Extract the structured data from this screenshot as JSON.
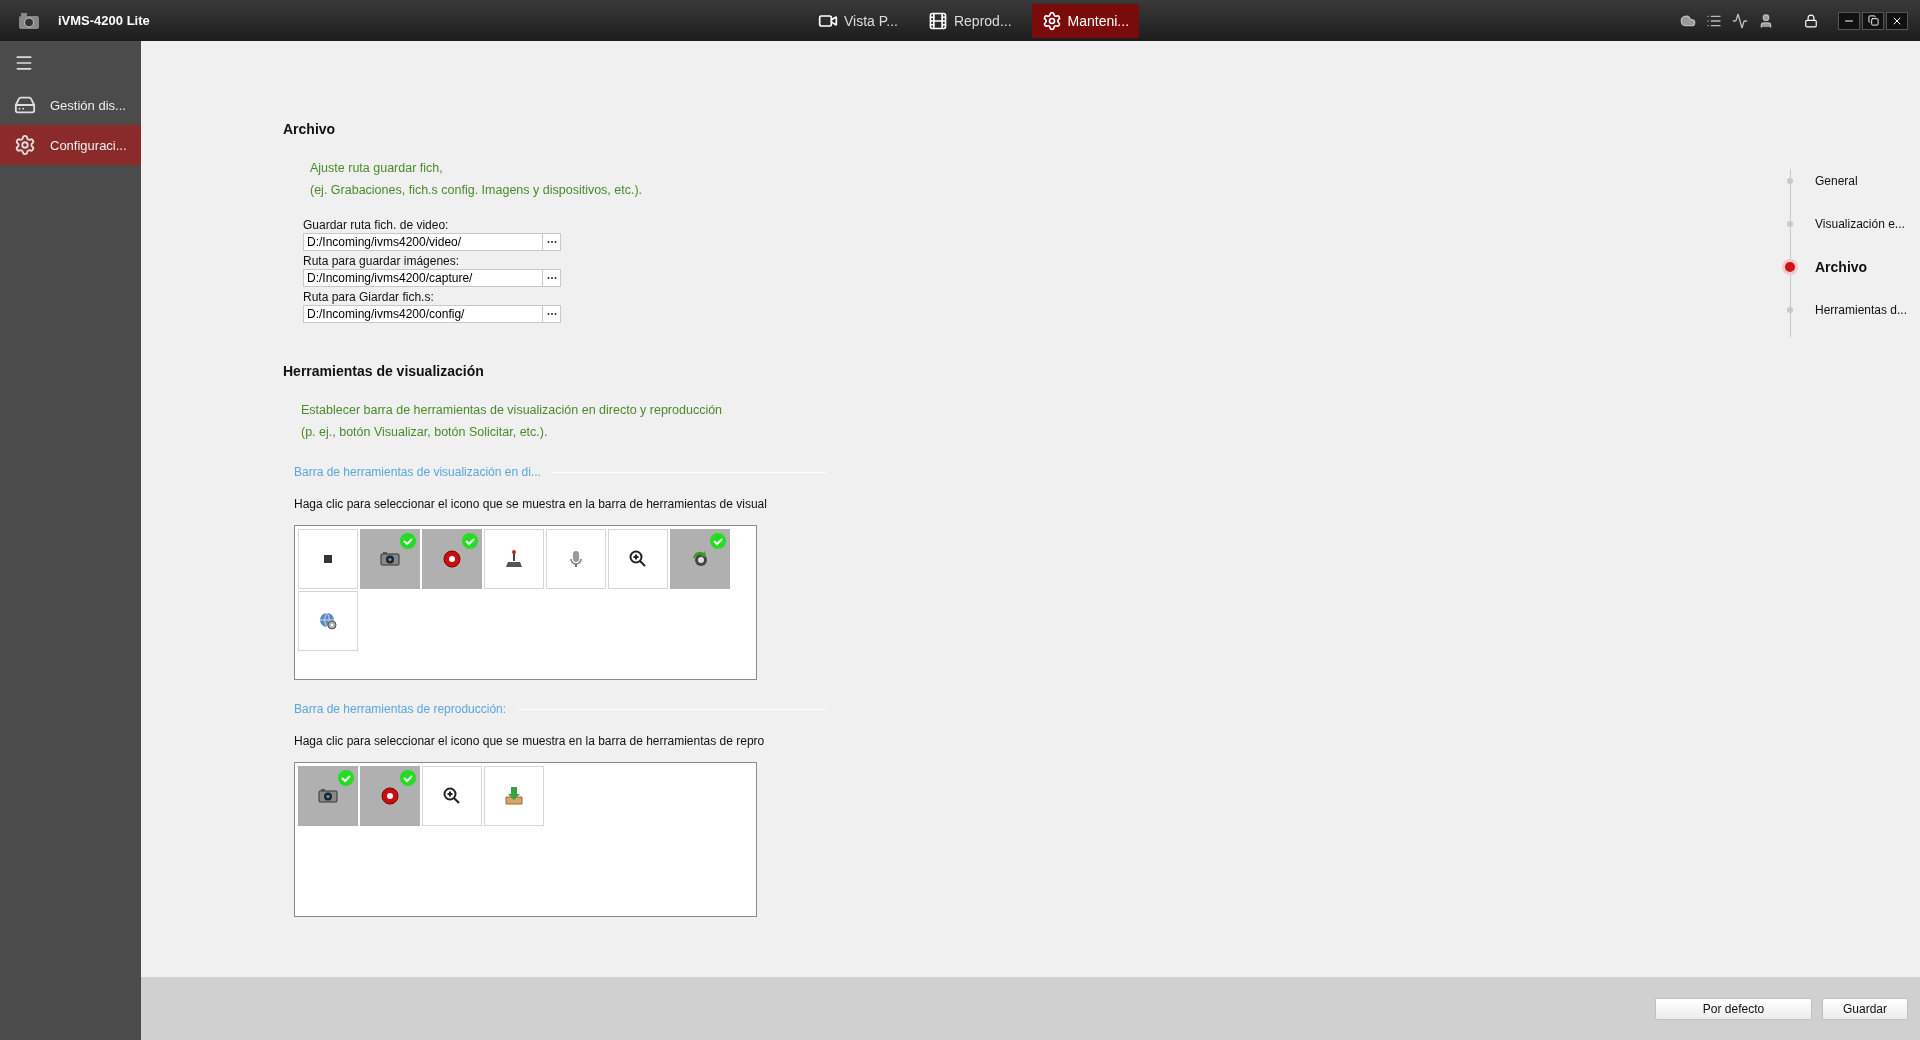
{
  "window": {
    "title": "iVMS-4200 Lite"
  },
  "tabs": [
    {
      "label": "Vista P...",
      "kind": "live",
      "selected": false
    },
    {
      "label": "Reprod...",
      "kind": "playback",
      "selected": false
    },
    {
      "label": "Manteni...",
      "kind": "maintenance",
      "selected": true
    }
  ],
  "sidebar": {
    "items": [
      {
        "label": "Gestión dis...",
        "kind": "device",
        "selected": false
      },
      {
        "label": "Configuraci...",
        "kind": "settings",
        "selected": true
      }
    ]
  },
  "file_section": {
    "title": "Archivo",
    "description": [
      "Ajuste ruta guardar fich,",
      "(ej. Grabaciones, fich.s config. Imagens y dispositivos, etc.)."
    ],
    "fields": [
      {
        "label": "Guardar ruta fich. de video:",
        "value": "D:/Incoming/ivms4200/video/"
      },
      {
        "label": "Ruta para guardar imágenes:",
        "value": "D:/Incoming/ivms4200/capture/"
      },
      {
        "label": "Ruta para Giardar fich.s:",
        "value": "D:/Incoming/ivms4200/config/"
      }
    ]
  },
  "toolbar_section": {
    "title": "Herramientas de visualización",
    "description": [
      "Establecer barra de herramientas de visualización en directo y reproducción",
      "(p. ej., botón Visualizar, botón Solicitar, etc.)."
    ],
    "groups": [
      {
        "title": "Barra de herramientas de visualización en di...",
        "instruction": "Haga clic para seleccionar el icono que se muestra en la barra de herramientas de visual",
        "tiles": [
          {
            "kind": "stop",
            "selected": false
          },
          {
            "kind": "snapshot",
            "selected": true
          },
          {
            "kind": "record",
            "selected": true
          },
          {
            "kind": "ptz",
            "selected": false
          },
          {
            "kind": "audio",
            "selected": false
          },
          {
            "kind": "zoom",
            "selected": false
          },
          {
            "kind": "refresh",
            "selected": true
          },
          {
            "kind": "globe",
            "selected": false
          }
        ]
      },
      {
        "title": "Barra de herramientas de reproducción:",
        "instruction": "Haga clic para seleccionar el icono que se muestra en la barra de herramientas de repro",
        "tiles": [
          {
            "kind": "snapshot",
            "selected": true
          },
          {
            "kind": "record",
            "selected": true
          },
          {
            "kind": "zoom",
            "selected": false
          },
          {
            "kind": "download",
            "selected": false
          }
        ]
      }
    ]
  },
  "section_nav": [
    {
      "label": "General",
      "selected": false
    },
    {
      "label": "Visualización e...",
      "selected": false
    },
    {
      "label": "Archivo",
      "selected": true
    },
    {
      "label": "Herramientas d...",
      "selected": false
    }
  ],
  "buttons": [
    "Por defecto",
    "Guardar"
  ]
}
